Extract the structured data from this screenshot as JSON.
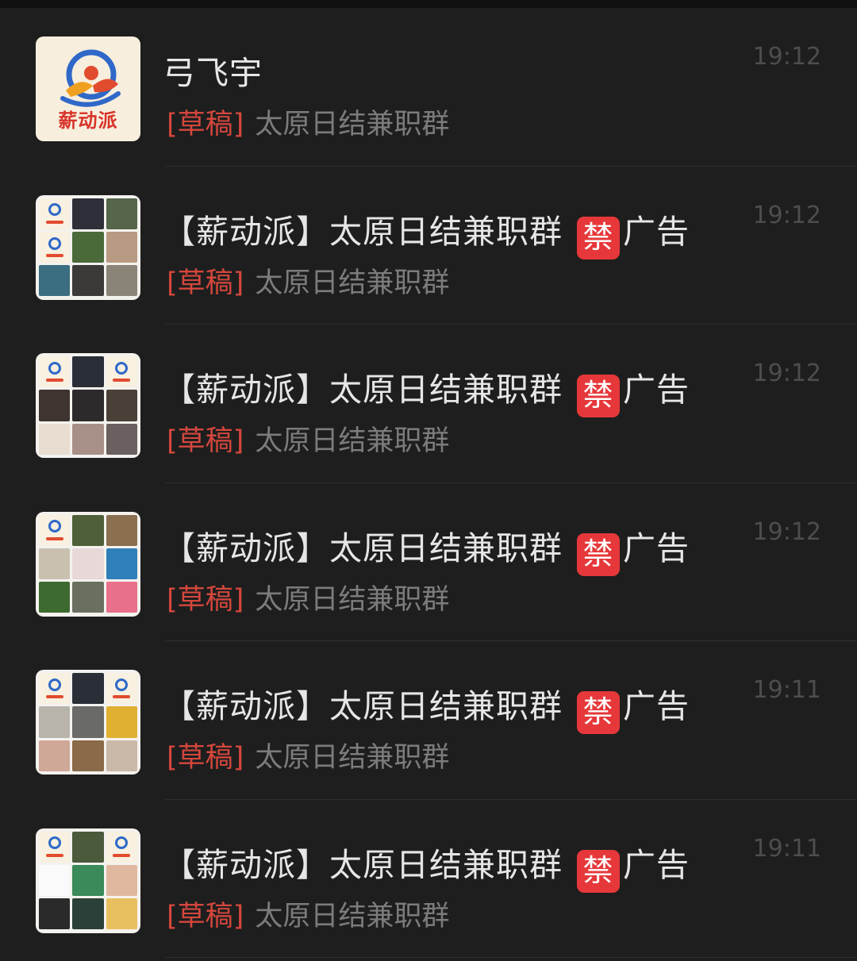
{
  "colors": {
    "background": "#1e1e1e",
    "title": "#e6e6e6",
    "draft_tag": "#d4473d",
    "preview": "#7c7c7c",
    "time": "#4d4d4d",
    "ban_badge": "#e6383a"
  },
  "chats": [
    {
      "name": "弓飞宇",
      "badge": "",
      "suffix": "",
      "draft_tag": "[草稿]",
      "preview": "太原日结兼职群",
      "time": "19:12",
      "avatar": {
        "type": "brand-logo",
        "brand_text": "薪动派"
      }
    },
    {
      "name": "【薪动派】太原日结兼职群",
      "badge": "禁",
      "suffix": "广告",
      "draft_tag": "[草稿]",
      "preview": "太原日结兼职群",
      "time": "19:12",
      "avatar": {
        "type": "group-collage",
        "cells": [
          "logo",
          "#2d3038",
          "#55664a",
          "logo",
          "#4a6a3a",
          "#b89a82",
          "#3a6e80",
          "#3b3a38",
          "#8a8478"
        ]
      }
    },
    {
      "name": "【薪动派】太原日结兼职群",
      "badge": "禁",
      "suffix": "广告",
      "draft_tag": "[草稿]",
      "preview": "太原日结兼职群",
      "time": "19:12",
      "avatar": {
        "type": "group-collage",
        "cells": [
          "logo",
          "#2a2e36",
          "logo",
          "#3e3430",
          "#2c2a2a",
          "#4a4038",
          "#e8ddd0",
          "#a89088",
          "#6a6060"
        ]
      }
    },
    {
      "name": "【薪动派】太原日结兼职群",
      "badge": "禁",
      "suffix": "广告",
      "draft_tag": "[草稿]",
      "preview": "太原日结兼职群",
      "time": "19:12",
      "avatar": {
        "type": "group-collage",
        "cells": [
          "logo",
          "#4e6038",
          "#8a7050",
          "#c9c0b0",
          "#e8d8d8",
          "#2f80b8",
          "#3d6a30",
          "#6a7060",
          "#e8708a"
        ]
      }
    },
    {
      "name": "【薪动派】太原日结兼职群",
      "badge": "禁",
      "suffix": "广告",
      "draft_tag": "[草稿]",
      "preview": "太原日结兼职群",
      "time": "19:11",
      "avatar": {
        "type": "group-collage",
        "cells": [
          "logo",
          "#2a2e36",
          "logo",
          "#b8b4ac",
          "#6a6a66",
          "#e0b030",
          "#d0a898",
          "#8a6a48",
          "#cab8a8"
        ]
      }
    },
    {
      "name": "【薪动派】太原日结兼职群",
      "badge": "禁",
      "suffix": "广告",
      "draft_tag": "[草稿]",
      "preview": "太原日结兼职群",
      "time": "19:11",
      "avatar": {
        "type": "group-collage",
        "cells": [
          "logo",
          "#4a5a3a",
          "logo",
          "#fafafa",
          "#3a8a5a",
          "#e0b8a0",
          "#2a2a2a",
          "#2a4038",
          "#e8c060"
        ]
      }
    }
  ]
}
